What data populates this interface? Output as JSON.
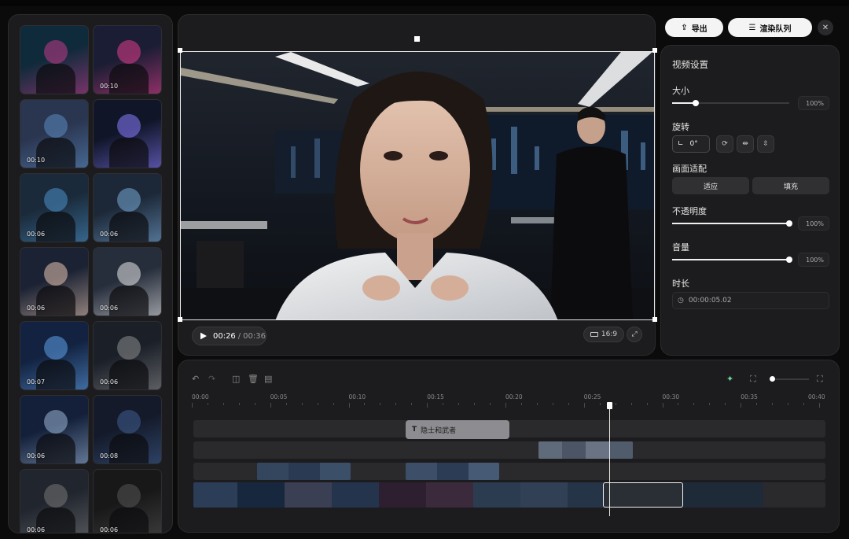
{
  "header": {
    "export_label": "导出",
    "export_icon": "share-export-icon",
    "render_queue_label": "渲染队列",
    "render_queue_icon": "queue-list-icon",
    "close_icon": "close-icon"
  },
  "media_library": {
    "items": [
      {
        "duration": "",
        "scene": "neon-mask"
      },
      {
        "duration": "00:10",
        "scene": "neon-street"
      },
      {
        "duration": "00:10",
        "scene": "city-silhouette"
      },
      {
        "duration": "",
        "scene": "cyber-fox-mask"
      },
      {
        "duration": "00:06",
        "scene": "server-room"
      },
      {
        "duration": "00:06",
        "scene": "man-monitors"
      },
      {
        "duration": "00:06",
        "scene": "woman-office"
      },
      {
        "duration": "00:06",
        "scene": "woman-white-suit"
      },
      {
        "duration": "00:07",
        "scene": "code-screen"
      },
      {
        "duration": "00:06",
        "scene": "man-desk-night"
      },
      {
        "duration": "00:06",
        "scene": "city-night-window"
      },
      {
        "duration": "00:08",
        "scene": "man-window-city"
      },
      {
        "duration": "00:06",
        "scene": "man-laptop"
      },
      {
        "duration": "00:06",
        "scene": "man-keyboard"
      }
    ]
  },
  "preview": {
    "current_time": "00:26",
    "separator": "/",
    "total_time": "00:36",
    "aspect_ratio": "16:9",
    "play_icon": "play-icon",
    "fullscreen_icon": "expand-icon"
  },
  "settings": {
    "title": "视频设置",
    "size_label": "大小",
    "size_value": "100%",
    "size_level": 0.2,
    "rotation_label": "旋转",
    "rotation_value": "0°",
    "fit_label": "画面适配",
    "fit_options": [
      "适应",
      "填充"
    ],
    "opacity_label": "不透明度",
    "opacity_value": "100%",
    "opacity_level": 1.0,
    "volume_label": "音量",
    "volume_value": "100%",
    "volume_level": 1.0,
    "duration_label": "时长",
    "duration_value": "00:00:05.02"
  },
  "timeline": {
    "ruler": [
      "00:00",
      "00:05",
      "00:10",
      "00:15",
      "00:20",
      "00:25",
      "00:30",
      "00:35",
      "00:40"
    ],
    "text_clip_label": "隐士和武者",
    "playhead_time": "00:26.5",
    "tools": [
      "undo-icon",
      "redo-icon",
      "split-icon",
      "delete-icon",
      "duplicate-icon"
    ],
    "right_tools": [
      "magic-icon",
      "fit-timeline-icon",
      "zoom-slider",
      "zoom-fit-icon"
    ]
  },
  "colors": {
    "background": "#0b0b0c",
    "panel": "#1c1c1e",
    "accent_white": "#f4f4f4",
    "text_clip": "#8d8d91",
    "magic_icon": "#6fd39a"
  }
}
